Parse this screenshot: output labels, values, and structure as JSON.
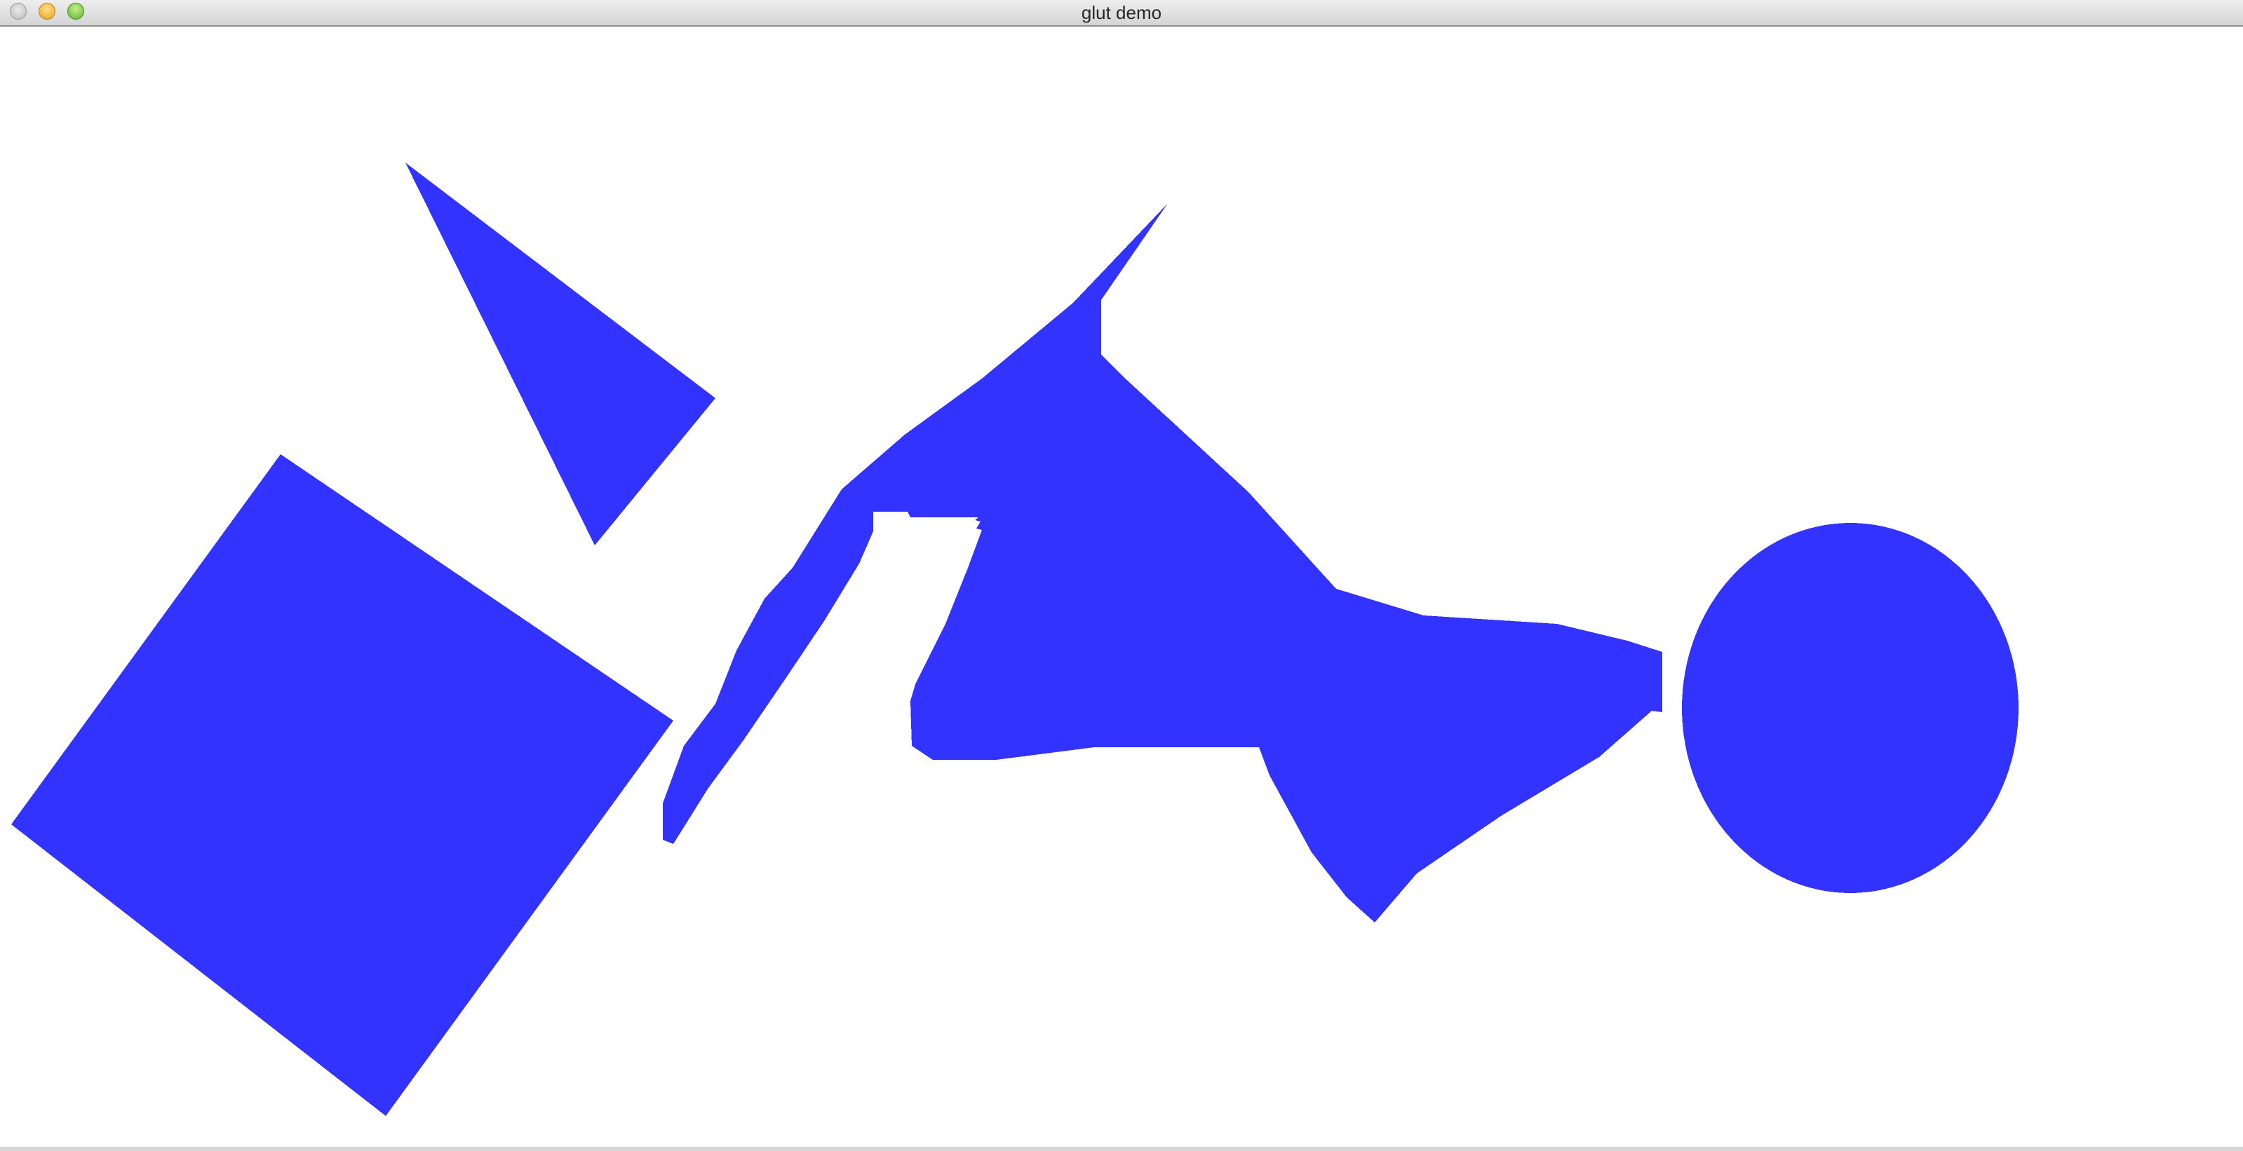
{
  "window": {
    "title": "glut demo"
  },
  "colors": {
    "fill": "#3333ff",
    "background": "#ffffff"
  },
  "scene": {
    "shapes": [
      "diamond",
      "triangle",
      "zigzag-polygon",
      "circle"
    ]
  }
}
